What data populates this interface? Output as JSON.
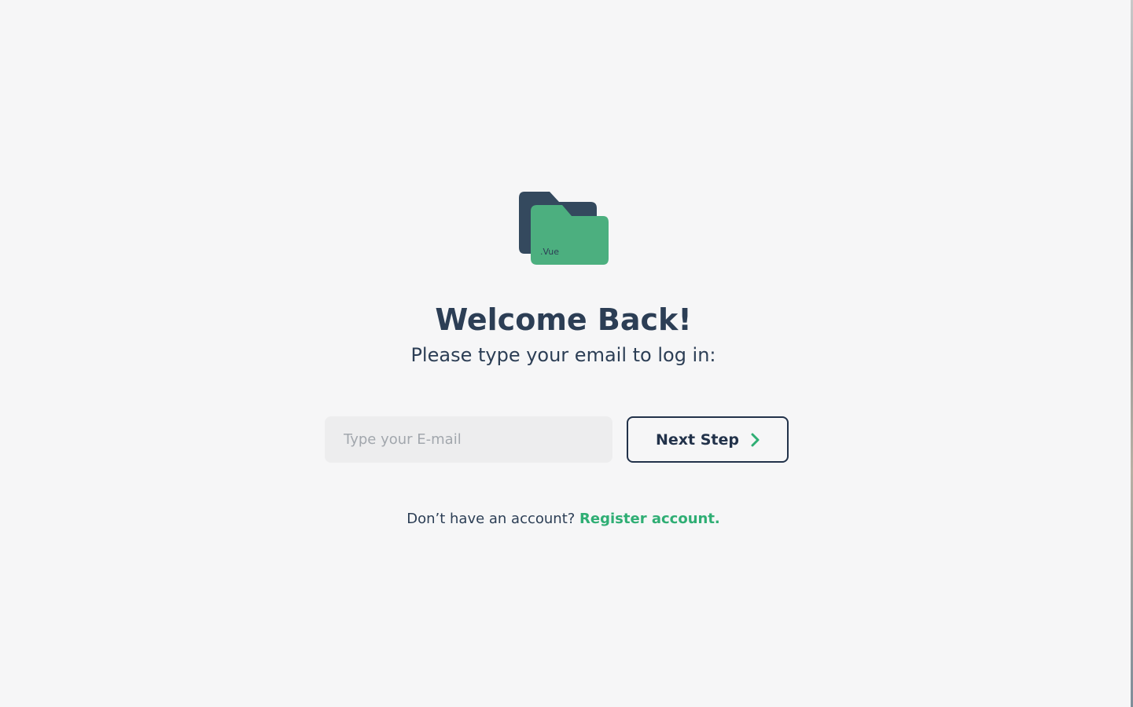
{
  "brand": {
    "logo_text": ".Vue",
    "icon": "folder-icon",
    "colors": {
      "back_folder": "#34495e",
      "front_folder": "#4caf7f",
      "accent": "#2fae74",
      "text": "#2c3e55"
    }
  },
  "login": {
    "title": "Welcome Back!",
    "subtitle": "Please type your email to log in:",
    "email_placeholder": "Type your E-mail",
    "email_value": "",
    "next_label": "Next Step",
    "next_icon": "chevron-right-icon"
  },
  "footer": {
    "prompt": "Don’t have an account?",
    "register_label": "Register account."
  }
}
